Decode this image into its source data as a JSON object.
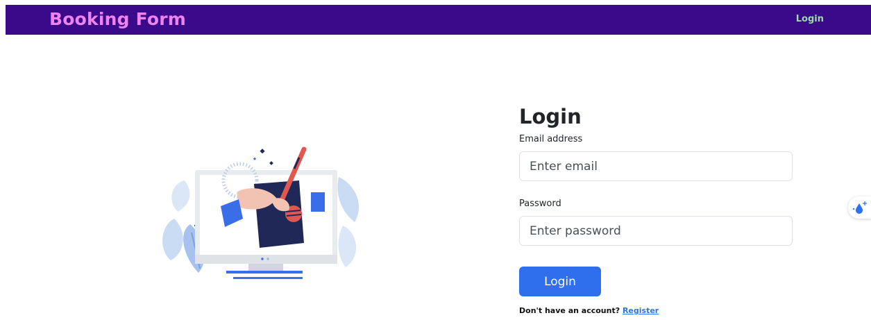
{
  "navbar": {
    "brand": "Booking Form",
    "login_link": "Login",
    "colors": {
      "background": "#3a0a8a",
      "brand": "#ee82ee",
      "link": "#9fd6b0"
    }
  },
  "illustration": {
    "icon": "computer-signing-illustration"
  },
  "login_form": {
    "title": "Login",
    "email": {
      "label": "Email address",
      "placeholder": "Enter email",
      "value": ""
    },
    "password": {
      "label": "Password",
      "placeholder": "Enter password",
      "value": ""
    },
    "submit_label": "Login",
    "signup_prompt": "Don't have an account?",
    "register_link": "Register",
    "colors": {
      "accent": "#2f6fed"
    }
  },
  "floating_widget": {
    "icon": "droplet-sparkle-icon"
  }
}
